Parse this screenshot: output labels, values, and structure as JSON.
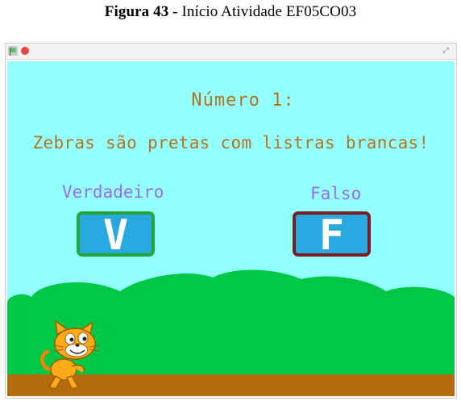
{
  "caption": {
    "prefix": "Figura 43 -",
    "text": " Início Atividade EF05CO03"
  },
  "player": {
    "fullscreen_glyph": "⤢"
  },
  "stage": {
    "question_number": "Número 1:",
    "question_text": "Zebras são pretas com listras brancas!",
    "true_label": "Verdadeiro",
    "false_label": "Falso",
    "true_button": "V",
    "false_button": "F"
  },
  "colors": {
    "sky": "#94ffff",
    "grass": "#00c846",
    "ground": "#b36d0f",
    "question_text": "#b5731f",
    "option_label": "#9b6cf0",
    "button_fill": "#29a8e0",
    "true_border": "#23a537",
    "false_border": "#7a1d1d"
  },
  "icons": {
    "green_flag": "green-flag-icon",
    "stop": "stop-icon",
    "fullscreen": "fullscreen-icon",
    "sprite": "scratch-cat"
  }
}
